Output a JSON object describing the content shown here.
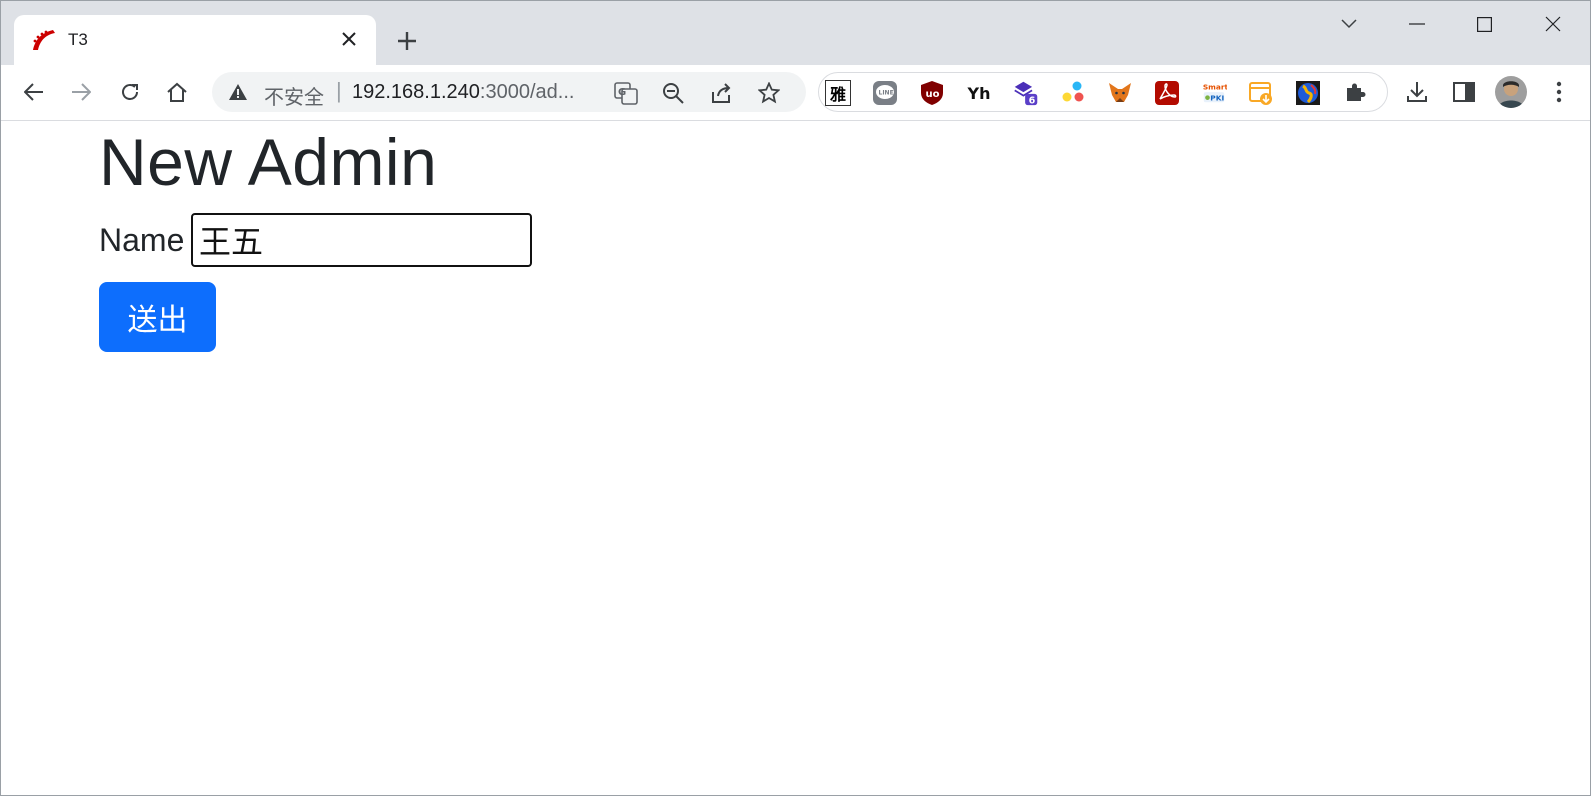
{
  "browser": {
    "tab": {
      "title": "T3",
      "favicon": "rails-icon"
    },
    "omnibox": {
      "security_label": "不安全",
      "separator": "|",
      "url_host": "192.168.1.240",
      "url_rest": ":3000/ad..."
    },
    "extensions": {
      "first_label": "雅",
      "yh_label": "Yh",
      "badge_count": "6",
      "pki_top": "Smart",
      "pki_bottom": "PKI"
    }
  },
  "page": {
    "heading": "New Admin",
    "name_label": "Name",
    "name_value": "王五",
    "submit_label": "送出"
  },
  "colors": {
    "primary_button": "#0d6efd",
    "tabstrip_bg": "#dee1e6"
  }
}
